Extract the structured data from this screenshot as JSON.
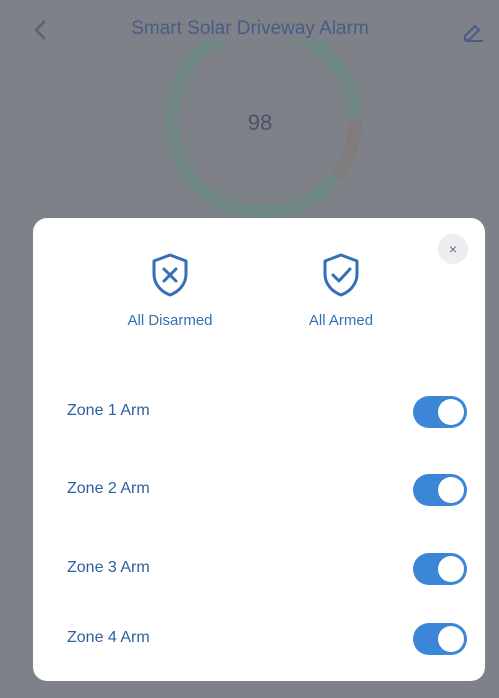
{
  "app": {
    "title": "Smart Solar Driveway Alarm",
    "back_icon": "chevron-left-icon",
    "edit_icon": "edit-icon"
  },
  "status": {
    "value": "98"
  },
  "modal": {
    "close_label": "×",
    "modes": [
      {
        "label": "All Disarmed",
        "icon": "shield-x-icon"
      },
      {
        "label": "All Armed",
        "icon": "shield-check-icon"
      }
    ],
    "zones": [
      {
        "label": "Zone 1 Arm",
        "on": true
      },
      {
        "label": "Zone 2 Arm",
        "on": true
      },
      {
        "label": "Zone 3 Arm",
        "on": true
      },
      {
        "label": "Zone 4 Arm",
        "on": true
      }
    ]
  },
  "colors": {
    "overlay": "#7e8188",
    "accent": "#3b86d6",
    "label": "#2e5f9e",
    "icon": "#356fb6"
  }
}
